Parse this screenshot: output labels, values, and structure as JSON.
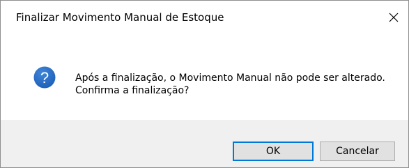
{
  "dialog": {
    "title": "Finalizar Movimento Manual de Estoque",
    "icon": "question-icon",
    "message": "Após a finalização, o Movimento Manual não pode ser alterado. Confirma a finalização?",
    "buttons": {
      "ok": "OK",
      "cancel": "Cancelar"
    },
    "colors": {
      "icon_blue": "#1e5eb7",
      "focus_border": "#0078d7",
      "footer_bg": "#f0f0f0"
    }
  }
}
